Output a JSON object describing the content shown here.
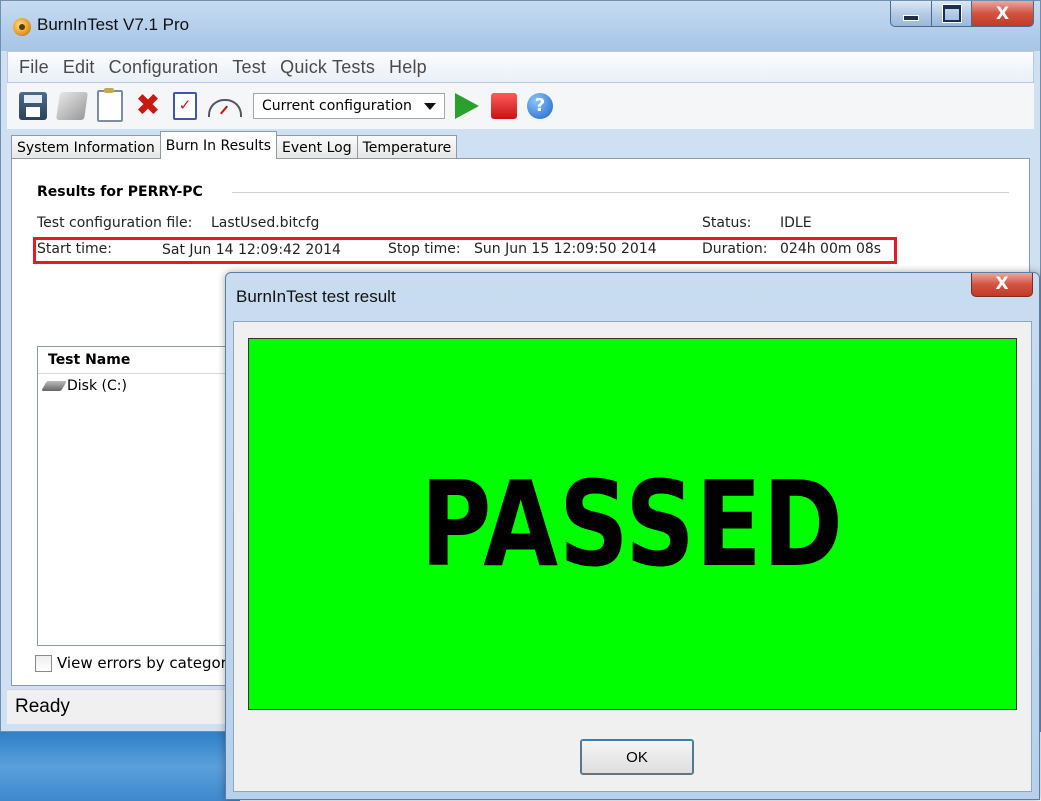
{
  "window": {
    "title": "BurnInTest V7.1 Pro",
    "caption_close": "X"
  },
  "menu": [
    "File",
    "Edit",
    "Configuration",
    "Test",
    "Quick Tests",
    "Help"
  ],
  "toolbar": {
    "config_select": "Current configuration",
    "icons": [
      "save-icon",
      "disk-icon",
      "clipboard-icon",
      "delete-icon",
      "checklist-icon",
      "gauge-icon",
      "play-icon",
      "stop-icon",
      "help-icon"
    ],
    "help_glyph": "?"
  },
  "tabs": [
    {
      "label": "System Information",
      "active": false
    },
    {
      "label": "Burn In Results",
      "active": true
    },
    {
      "label": "Event Log",
      "active": false
    },
    {
      "label": "Temperature",
      "active": false
    }
  ],
  "results": {
    "group_title": "Results for PERRY-PC",
    "config_file_label": "Test configuration file:",
    "config_file_value": "LastUsed.bitcfg",
    "status_label": "Status:",
    "status_value": "IDLE",
    "start_label": "Start time:",
    "start_value": "Sat Jun 14 12:09:42 2014",
    "stop_label": "Stop time:",
    "stop_value": "Sun Jun 15 12:09:50 2014",
    "duration_label": "Duration:",
    "duration_value": "024h 00m 08s"
  },
  "test_list": {
    "header": "Test Name",
    "rows": [
      "Disk (C:)"
    ]
  },
  "checkbox_label": "View errors by categor",
  "statusbar": "Ready",
  "dialog": {
    "title": "BurnInTest test result",
    "close": "X",
    "result_text": "PASSED",
    "ok_label": "OK"
  },
  "colors": {
    "passed_bg": "#00ff00",
    "highlight_border": "#e21b2b",
    "titlebar": "#b3cdea"
  }
}
